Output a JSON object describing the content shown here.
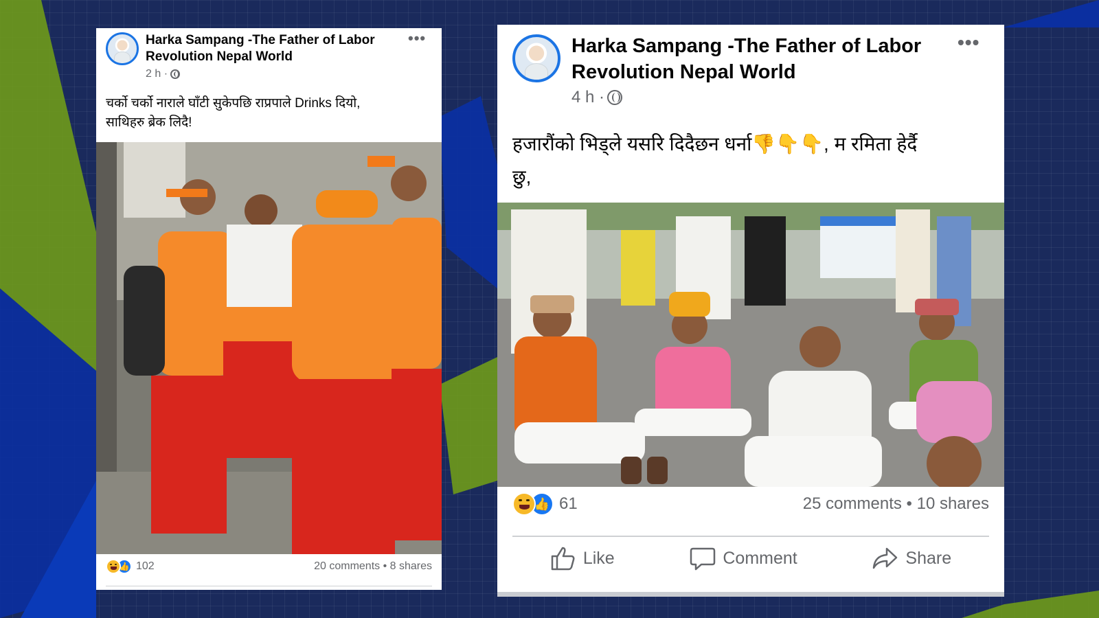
{
  "colors": {
    "background": "#1a2a5c",
    "accent_green": "#7a9a1e",
    "accent_blue": "#0c2a8c",
    "fb_blue": "#1877f2",
    "text_secondary": "#65676b"
  },
  "posts": [
    {
      "author": "Harka Sampang -The Father of Labor Revolution Nepal World",
      "author_line1": "Harka Sampang -The Father of Labor",
      "author_line2": "Revolution Nepal World",
      "time": "2 h ·",
      "audience_icon": "globe-icon",
      "caption_line1": "चर्को चर्को नाराले घाँटी सुकेपछि राप्रपाले Drinks दियो,",
      "caption_line2": "साथिहरु ब्रेक लिदै!",
      "photo_description_icon": "photo",
      "reaction_icons": [
        "haha-icon",
        "like-icon"
      ],
      "reaction_count": "102",
      "stats": "20 comments • 8 shares"
    },
    {
      "author": "Harka Sampang -The Father of Labor Revolution Nepal World",
      "author_line1": "Harka Sampang -The Father of Labor",
      "author_line2": "Revolution Nepal World",
      "time": "4 h ·",
      "audience_icon": "globe-icon",
      "caption_line1": "हजारौंको भिड्ले यसरि दिदैछन धर्ना👎👇👇, म रमिता हेर्दै",
      "caption_line2": "छु,",
      "reaction_icons": [
        "haha-icon",
        "like-icon"
      ],
      "reaction_count": "61",
      "stats": "25 comments • 10 shares",
      "actions": {
        "like": "Like",
        "comment": "Comment",
        "share": "Share"
      }
    }
  ]
}
